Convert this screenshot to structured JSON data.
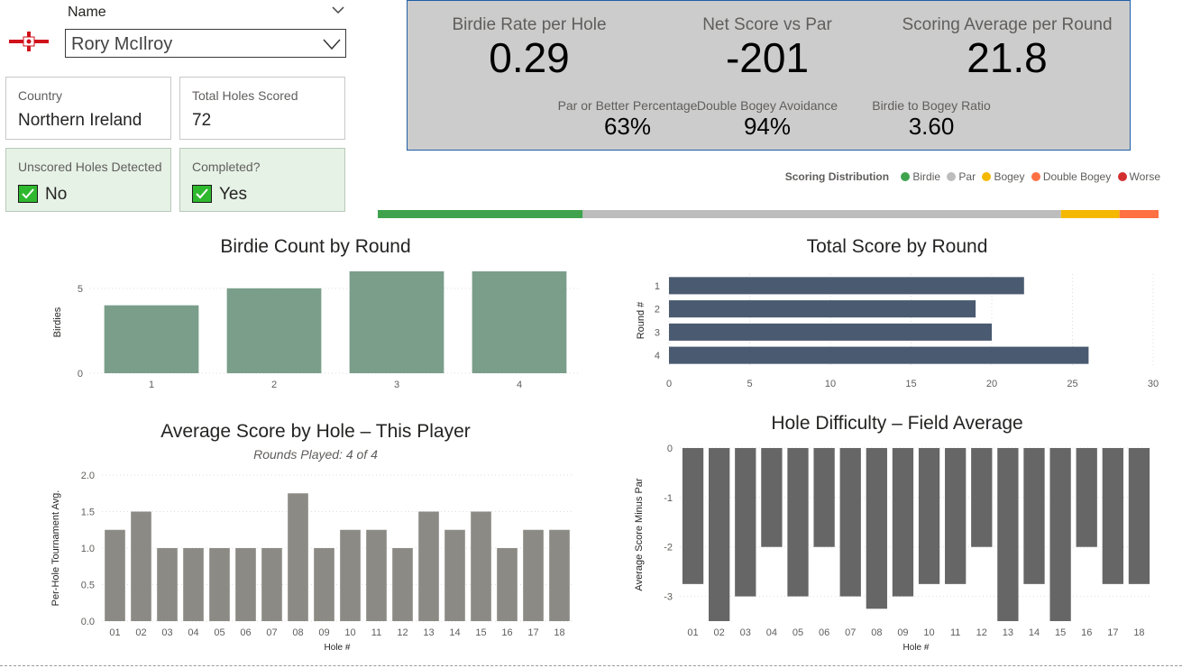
{
  "slicer": {
    "label": "Name",
    "value": "Rory McIlroy"
  },
  "cards": {
    "country": {
      "title": "Country",
      "value": "Northern Ireland"
    },
    "holes": {
      "title": "Total Holes Scored",
      "value": "72"
    },
    "unscored": {
      "title": "Unscored Holes Detected",
      "value": "No"
    },
    "completed": {
      "title": "Completed?",
      "value": "Yes"
    }
  },
  "kpis": {
    "birdie_rate": {
      "label": "Birdie Rate per Hole",
      "value": "0.29"
    },
    "net_score": {
      "label": "Net Score vs Par",
      "value": "-201"
    },
    "scoring_avg": {
      "label": "Scoring Average per Round",
      "value": "21.8"
    },
    "par_or_better": {
      "label": "Par or Better Percentage",
      "value": "63%"
    },
    "dbl_bogey_avoid": {
      "label": "Double Bogey Avoidance",
      "value": "94%"
    },
    "birdie_bogey": {
      "label": "Birdie to Bogey Ratio",
      "value": "3.60"
    }
  },
  "legend": {
    "title": "Scoring Distribution",
    "items": [
      {
        "label": "Birdie",
        "color": "#3fa34d"
      },
      {
        "label": "Par",
        "color": "#bdbdbd"
      },
      {
        "label": "Bogey",
        "color": "#f5b800"
      },
      {
        "label": "Double Bogey",
        "color": "#ff7043"
      },
      {
        "label": "Worse",
        "color": "#d32f2f"
      }
    ]
  },
  "chart_data": [
    {
      "type": "bar",
      "id": "distribution",
      "title": "Scoring Distribution",
      "categories": [
        "Birdie",
        "Par",
        "Bogey",
        "Double Bogey",
        "Worse"
      ],
      "values": [
        21,
        49,
        6,
        4,
        0
      ],
      "colors": [
        "#3fa34d",
        "#bdbdbd",
        "#f5b800",
        "#ff7043",
        "#d32f2f"
      ]
    },
    {
      "type": "bar",
      "id": "birdies",
      "title": "Birdie Count by Round",
      "categories": [
        "1",
        "2",
        "3",
        "4"
      ],
      "values": [
        4,
        5,
        6,
        6
      ],
      "ylabel": "Birdies",
      "yticks": [
        0,
        5
      ],
      "ylim": [
        0,
        6
      ],
      "color": "#7a9e8a"
    },
    {
      "type": "bar",
      "id": "total-score",
      "orientation": "horizontal",
      "title": "Total Score by Round",
      "categories": [
        "1",
        "2",
        "3",
        "4"
      ],
      "values": [
        22,
        19,
        20,
        26
      ],
      "ylabel": "Round #",
      "xticks": [
        0,
        5,
        10,
        15,
        20,
        25,
        30
      ],
      "xlim": [
        0,
        30
      ],
      "color": "#4a5a70"
    },
    {
      "type": "bar",
      "id": "avg-score",
      "title": "Average Score by Hole – This Player",
      "subtitle": "Rounds Played: 4 of 4",
      "categories": [
        "01",
        "02",
        "03",
        "04",
        "05",
        "06",
        "07",
        "08",
        "09",
        "10",
        "11",
        "12",
        "13",
        "14",
        "15",
        "16",
        "17",
        "18"
      ],
      "values": [
        1.25,
        1.5,
        1.0,
        1.0,
        1.0,
        1.0,
        1.0,
        1.75,
        1.0,
        1.25,
        1.25,
        1.0,
        1.5,
        1.25,
        1.5,
        1.0,
        1.25,
        1.25
      ],
      "xlabel": "Hole #",
      "ylabel": "Per-Hole Tournament Avg.",
      "yticks": [
        "0.0",
        "0.5",
        "1.0",
        "1.5",
        "2.0"
      ],
      "ylim": [
        0,
        2
      ],
      "color": "#8c8a84"
    },
    {
      "type": "bar",
      "id": "difficulty",
      "title": "Hole Difficulty – Field Average",
      "categories": [
        "01",
        "02",
        "03",
        "04",
        "05",
        "06",
        "07",
        "08",
        "09",
        "10",
        "11",
        "12",
        "13",
        "14",
        "15",
        "16",
        "17",
        "18"
      ],
      "values": [
        -2.75,
        -3.5,
        -3.0,
        -2.0,
        -3.0,
        -2.0,
        -3.0,
        -3.25,
        -3.0,
        -2.75,
        -2.75,
        -2.0,
        -3.5,
        -2.75,
        -3.5,
        -2.0,
        -2.75,
        -2.75
      ],
      "xlabel": "Hole #",
      "ylabel": "Average Score Minus Par",
      "yticks": [
        0,
        -1,
        -2,
        -3
      ],
      "ylim": [
        -3.5,
        0
      ],
      "color": "#666666"
    }
  ]
}
